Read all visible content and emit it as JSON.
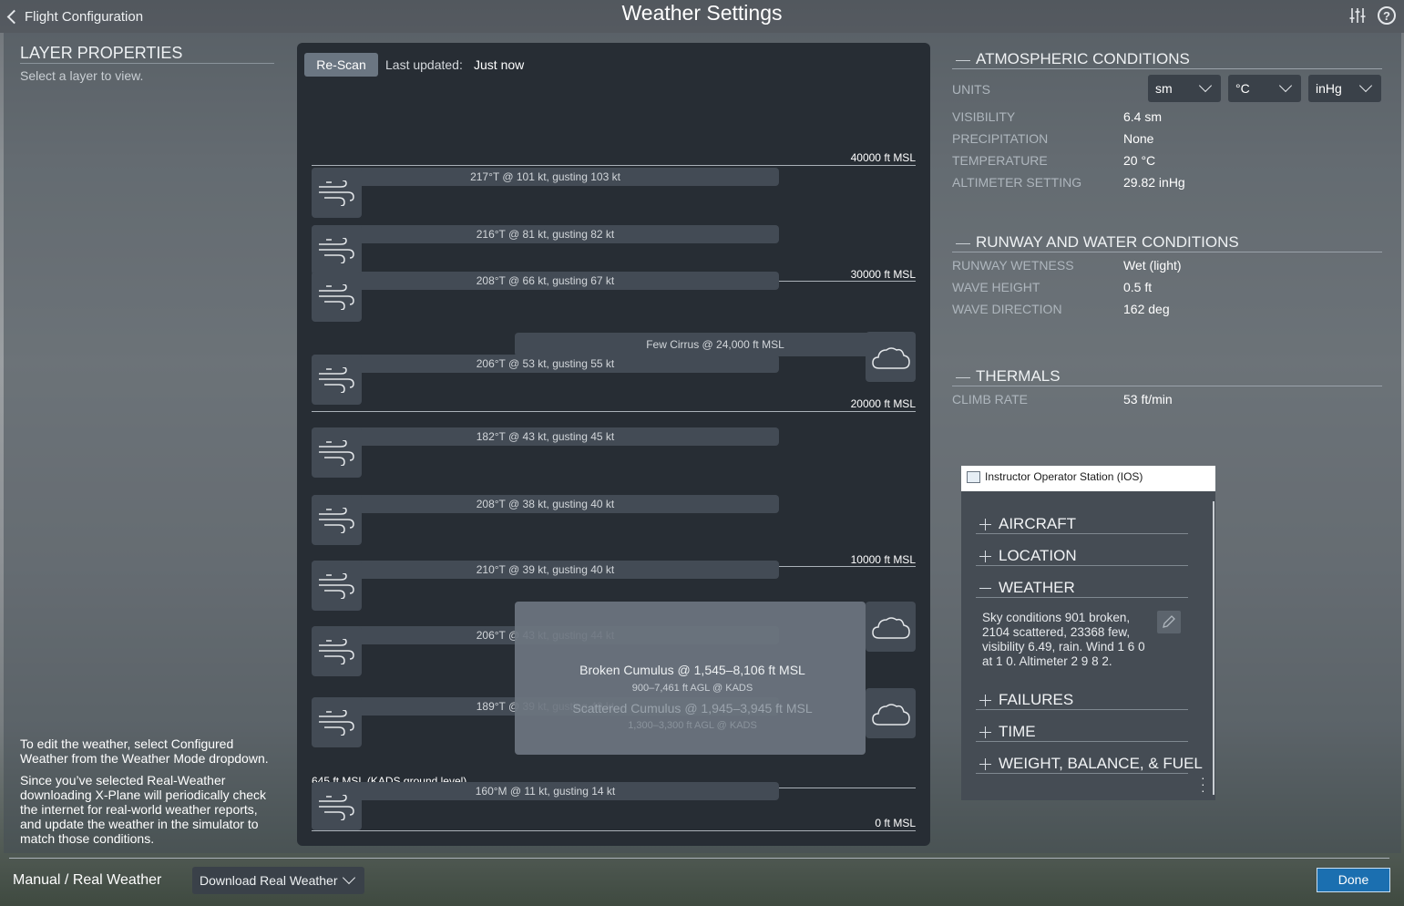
{
  "header": {
    "back_label": "Flight Configuration",
    "title": "Weather Settings"
  },
  "layer_panel": {
    "title": "LAYER PROPERTIES",
    "subtitle": "Select a layer to view.",
    "edit_note": "To edit the weather, select Configured Weather from the Weather Mode dropdown.",
    "real_weather_note": "Since you’ve selected Real-Weather downloading X-Plane will periodically check the internet for real-world weather reports, and update the weather in the simulator to match those conditions."
  },
  "chart": {
    "rescan_label": "Re-Scan",
    "last_updated_label": "Last updated:",
    "last_updated_value": "Just now",
    "altitude_labels": [
      "40000 ft MSL",
      "30000 ft MSL",
      "20000 ft MSL",
      "10000 ft MSL",
      "0 ft MSL"
    ],
    "ground_label": "645 ft MSL (KADS ground level)",
    "wind_layers": [
      "217°T @ 101 kt, gusting 103 kt",
      "216°T @ 81 kt, gusting 82 kt",
      "208°T @ 66 kt, gusting 67 kt",
      "206°T @ 53 kt, gusting 55 kt",
      "182°T @ 43 kt, gusting 45 kt",
      "208°T @ 38 kt, gusting 40 kt",
      "210°T @ 39 kt, gusting 40 kt",
      "206°T @ 43 kt, gusting 44 kt",
      "189°T @ 39 kt, gusting 40 kt",
      "160°M @ 11 kt, gusting 14 kt"
    ],
    "cloud_layers": [
      "Few Cirrus @ 24,000 ft MSL"
    ],
    "tooltip": {
      "title": "Broken Cumulus @ 1,545–8,106 ft MSL",
      "sub": "900–7,461 ft AGL @ KADS",
      "title2": "Scattered Cumulus @ 1,945–3,945 ft MSL",
      "sub2": "1,300–3,300 ft AGL @ KADS"
    }
  },
  "atmospheric": {
    "title": "ATMOSPHERIC CONDITIONS",
    "units_label": "UNITS",
    "units": [
      "sm",
      "°C",
      "inHg"
    ],
    "rows": [
      {
        "label": "VISIBILITY",
        "value": "6.4 sm"
      },
      {
        "label": "PRECIPITATION",
        "value": "None"
      },
      {
        "label": "TEMPERATURE",
        "value": "20 °C"
      },
      {
        "label": "ALTIMETER SETTING",
        "value": "29.82 inHg"
      }
    ]
  },
  "runway": {
    "title": "RUNWAY AND WATER CONDITIONS",
    "rows": [
      {
        "label": "RUNWAY WETNESS",
        "value": "Wet (light)"
      },
      {
        "label": "WAVE HEIGHT",
        "value": "0.5 ft"
      },
      {
        "label": "WAVE DIRECTION",
        "value": "162 deg"
      }
    ]
  },
  "thermals": {
    "title": "THERMALS",
    "rows": [
      {
        "label": "CLIMB RATE",
        "value": "53 ft/min"
      }
    ]
  },
  "ios": {
    "window_title": "Instructor Operator Station (IOS)",
    "sections": [
      "AIRCRAFT",
      "LOCATION",
      "WEATHER",
      "FAILURES",
      "TIME",
      "WEIGHT, BALANCE, & FUEL"
    ],
    "weather_text": "Sky conditions 901 broken, 2104 scattered, 23368 few, visibility 6.49, rain. Wind  1 6 0  at  1 0. Altimeter  2 9 8 2."
  },
  "bottom": {
    "mode_label": "Manual / Real Weather",
    "mode_value": "Download Real Weather",
    "done_label": "Done"
  },
  "colors": {
    "accent": "#1b6fb0",
    "panel": "#272d34"
  }
}
